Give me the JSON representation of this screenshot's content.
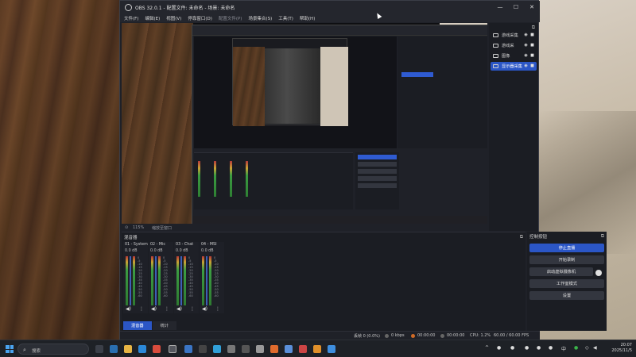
{
  "window": {
    "title": "OBS 32.0.1 - 配置文件: 未命名 - 场景: 未命名",
    "controls": {
      "minimize": "—",
      "maximize": "☐",
      "close": "✕"
    }
  },
  "menu": {
    "items": [
      "文件(F)",
      "编辑(E)",
      "视图(V)",
      "停靠窗口(D)",
      "配置文件(P)",
      "场景集合(S)",
      "工具(T)",
      "帮助(H)"
    ]
  },
  "zoom_label": "115%",
  "zoom_hint": "缩放至窗口",
  "scenes": {
    "items": [
      {
        "label": "游戏采集"
      },
      {
        "label": "游戏采"
      },
      {
        "label": "图像"
      },
      {
        "label": "显示器采集",
        "active": true
      }
    ]
  },
  "mixer": {
    "title": "混音器",
    "channels": [
      {
        "name": "01 - System",
        "db": "0.0 dB"
      },
      {
        "name": "02 - Mic",
        "db": "0.0 dB"
      },
      {
        "name": "03 - Chat",
        "db": "0.0 dB"
      },
      {
        "name": "04 - MSI",
        "db": "0.0 dB"
      }
    ],
    "tabs": [
      {
        "label": "混音器",
        "active": true
      },
      {
        "label": "统计",
        "active": false
      }
    ]
  },
  "controls": {
    "title": "控制按钮",
    "buttons": [
      "停止直播",
      "开始录制",
      "启动虚拟摄像机",
      "工作室模式",
      "设置"
    ]
  },
  "status": {
    "dropped": "丢帧 0 (0.0%)",
    "bitrate": "0 kbps",
    "stream_time": "00:00:00",
    "rec_time": "00:00:00",
    "cpu": "CPU: 1.2%",
    "fps": "60.00 / 60.00 FPS"
  },
  "taskbar": {
    "search_placeholder": "搜索",
    "ime": "中",
    "time": "20:07",
    "date": "2025/11/5"
  },
  "colors": {
    "accent": "#2b56c6",
    "meter_green": "#3c9d42",
    "meter_yellow": "#c7a334",
    "meter_red": "#b63737"
  }
}
